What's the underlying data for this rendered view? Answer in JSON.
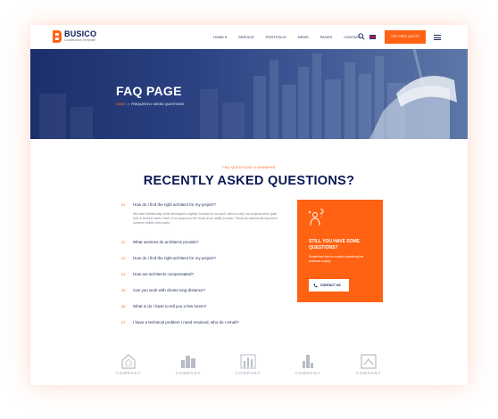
{
  "header": {
    "logo_name": "BUSICO",
    "logo_sub": "Construction Template",
    "nav": [
      "HOME",
      "SERVICE",
      "PORTFOLIO",
      "NEWS",
      "PAGES",
      "CONTACT"
    ],
    "nav_home_caret": "▾",
    "quote_label": "GET FREE QUOTE"
  },
  "hero": {
    "title": "FAQ PAGE",
    "breadcrumb_home": "HOME",
    "breadcrumb_sep": ">",
    "breadcrumb_current": "FREQUENTLY ASKED QUESTIONS"
  },
  "section": {
    "eyebrow": "FAQ QUESTIONS & ANSWERS",
    "title": "RECENTLY ASKED QUESTIONS?"
  },
  "faqs": [
    {
      "num": "01",
      "question": "How do I find the right architect for my project?",
      "answer": "We have intentionally never developed a stylistic formula for our work, which is why our projects never quite look or feel the same. Each of our spaces is the result of our ability to listen. These six statements represent common beliefs exist today."
    },
    {
      "num": "02",
      "question": "What services do architects provide?"
    },
    {
      "num": "03",
      "question": "How do I find the right architect for my project?"
    },
    {
      "num": "04",
      "question": "How are architects compensated?"
    },
    {
      "num": "05",
      "question": "Can you work with clients long distance?"
    },
    {
      "num": "06",
      "question": "What is do I have to tell you a few lorem?"
    },
    {
      "num": "07",
      "question": "I have a technical problem I need resolved, who do I email?"
    }
  ],
  "cta": {
    "title": "STILL YOU HAVE SOME QUESTIONS?",
    "text": "Please feel free to contact submitting the business inquiry",
    "button": "CONTACT US"
  },
  "brands": [
    "COMPANY",
    "COMPANY",
    "COMPANY",
    "COMPANY",
    "COMPANY"
  ],
  "colors": {
    "accent": "#ff6212",
    "navy": "#0b1a55",
    "hero": "#2a4080"
  }
}
